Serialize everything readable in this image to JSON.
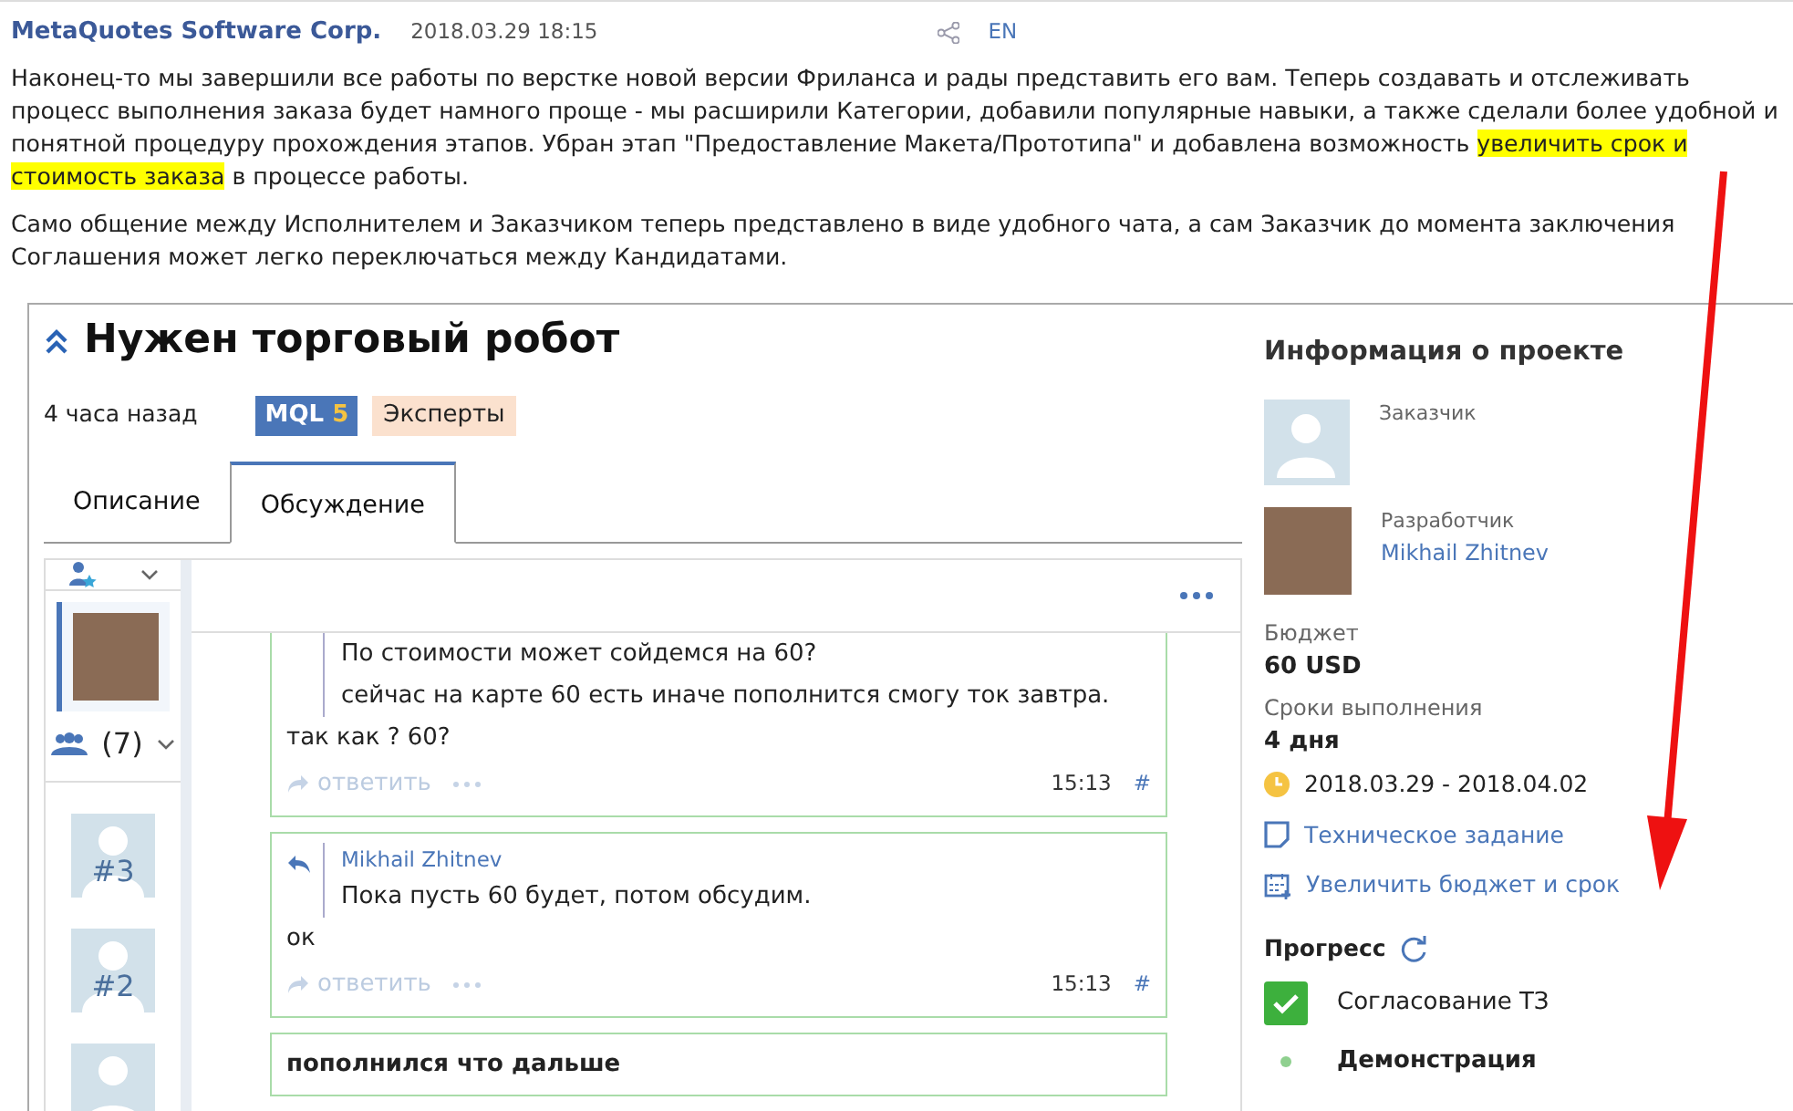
{
  "post": {
    "author": "MetaQuotes Software Corp.",
    "date": "2018.03.29 18:15",
    "language": "EN"
  },
  "paragraphs": [
    [
      {
        "text": "Наконец-то мы завершили все работы по верстке новой версии Фриланса и рады представить его вам. Теперь создавать и отслеживать процесс выполнения заказа будет намного проще - мы расширили Категории, добавили популярные навыки, а также сделали более удобной и понятной процедуру прохождения этапов. Убран этап \"Предоставление Макета/Прототипа\" и добавлена возможность ",
        "highlighted": false
      },
      {
        "text": "увеличить срок и стоимость заказа",
        "highlighted": true
      },
      {
        "text": " в процессе работы.",
        "highlighted": false
      }
    ],
    [
      {
        "text": "Само общение между Исполнителем и Заказчиком теперь представлено в виде удобного чата, а сам Заказчик до момента заключения Соглашения может легко переключаться между Кандидатами.",
        "highlighted": false
      }
    ]
  ],
  "project": {
    "title": "Нужен торговый робот",
    "age": "4 часа назад",
    "tags": [
      {
        "kind": "platform",
        "text": "MQL",
        "suffix": "5"
      },
      {
        "kind": "category",
        "text": "Эксперты"
      }
    ],
    "tabs": [
      {
        "label": "Описание",
        "selected": false
      },
      {
        "label": "Обсуждение",
        "selected": true
      }
    ],
    "chat": {
      "group_count": "(7)",
      "candidates": [
        {
          "kind": "photo",
          "selected": true
        },
        {
          "kind": "placeholder",
          "label": "#3",
          "selected": false
        },
        {
          "kind": "placeholder",
          "label": "#2",
          "selected": false
        },
        {
          "kind": "placeholder",
          "selected": false
        }
      ],
      "messages": [
        {
          "quote_lines": [
            "По стоимости может сойдемся на 60?",
            "сейчас на карте 60 есть иначе пополнится смогу ток завтра."
          ],
          "text": "так как ? 60?",
          "reply": "ответить",
          "time": "15:13",
          "anchor": "#"
        },
        {
          "quote_author": "Mikhail Zhitnev",
          "quote_lines": [
            "Пока пусть 60 будет, потом обсудим."
          ],
          "text": "ок",
          "reply": "ответить",
          "time": "15:13",
          "anchor": "#"
        },
        {
          "text": "пополнился что дальше"
        }
      ]
    }
  },
  "info": {
    "title": "Информация о проекте",
    "people": [
      {
        "role": "Заказчик",
        "photo": false
      },
      {
        "role": "Разработчик",
        "name": "Mikhail Zhitnev",
        "photo": true
      }
    ],
    "fields": [
      {
        "label": "Бюджет",
        "value": "60 USD"
      },
      {
        "label": "Сроки выполнения",
        "value": "4 дня"
      }
    ],
    "dates": "2018.03.29 - 2018.04.02",
    "links": [
      {
        "kind": "document",
        "text": "Техническое задание"
      },
      {
        "kind": "calendar",
        "text": "Увеличить бюджет и срок"
      }
    ],
    "progress_title": "Прогресс",
    "steps": [
      {
        "text": "Согласование ТЗ",
        "done": true
      },
      {
        "text": "Демонстрация",
        "done": false
      }
    ]
  }
}
